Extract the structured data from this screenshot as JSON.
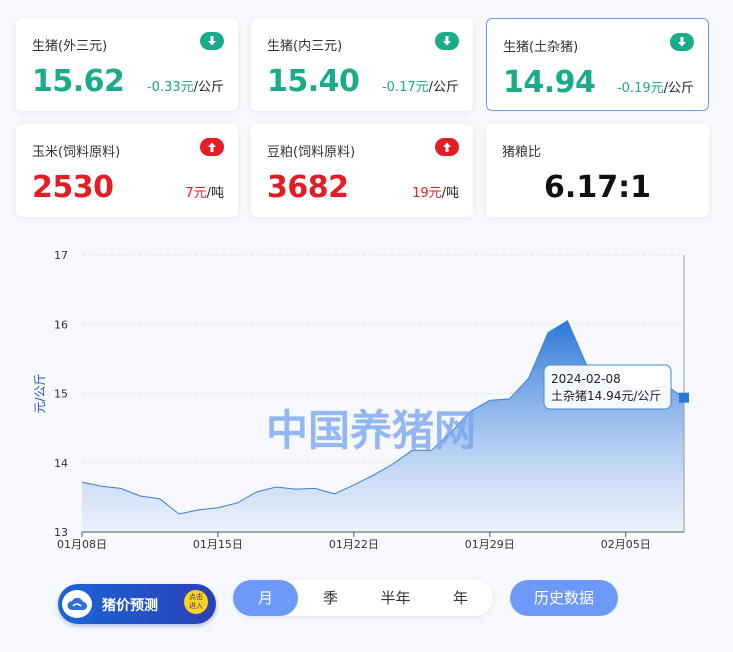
{
  "cards": [
    {
      "title": "生猪(外三元)",
      "value": "15.62",
      "change": "-0.33元",
      "unit": "/公斤",
      "trend": "down"
    },
    {
      "title": "生猪(内三元)",
      "value": "15.40",
      "change": "-0.17元",
      "unit": "/公斤",
      "trend": "down"
    },
    {
      "title": "生猪(土杂猪)",
      "value": "14.94",
      "change": "-0.19元",
      "unit": "/公斤",
      "trend": "down"
    },
    {
      "title": "玉米(饲料原料)",
      "value": "2530",
      "change": "7元",
      "unit": "/吨",
      "trend": "up"
    },
    {
      "title": "豆粕(饲料原料)",
      "value": "3682",
      "change": "19元",
      "unit": "/吨",
      "trend": "up"
    },
    {
      "title": "猪粮比",
      "value": "6.17:1"
    }
  ],
  "colors": {
    "down": "#1aab8a",
    "up": "#e41c24",
    "accent": "#6d9af8",
    "series": "#3a7fd5"
  },
  "chart_data": {
    "type": "area",
    "ylabel": "元/公斤",
    "ylim": [
      13,
      17
    ],
    "yticks": [
      13,
      14,
      15,
      16,
      17
    ],
    "xlim": [
      "2024-01-08",
      "2024-02-08"
    ],
    "xticks": [
      "01月08日",
      "01月15日",
      "01月22日",
      "01月29日",
      "02月05日"
    ],
    "grid": true,
    "watermark": "中国养猪网",
    "series": [
      {
        "name": "土杂猪",
        "values": [
          [
            "2024-01-08",
            13.72
          ],
          [
            "2024-01-09",
            13.66
          ],
          [
            "2024-01-10",
            13.63
          ],
          [
            "2024-01-11",
            13.52
          ],
          [
            "2024-01-12",
            13.48
          ],
          [
            "2024-01-13",
            13.26
          ],
          [
            "2024-01-14",
            13.32
          ],
          [
            "2024-01-15",
            13.35
          ],
          [
            "2024-01-16",
            13.42
          ],
          [
            "2024-01-17",
            13.58
          ],
          [
            "2024-01-18",
            13.65
          ],
          [
            "2024-01-19",
            13.62
          ],
          [
            "2024-01-20",
            13.63
          ],
          [
            "2024-01-21",
            13.55
          ],
          [
            "2024-01-22",
            13.68
          ],
          [
            "2024-01-23",
            13.82
          ],
          [
            "2024-01-24",
            13.98
          ],
          [
            "2024-01-25",
            14.18
          ],
          [
            "2024-01-26",
            14.18
          ],
          [
            "2024-01-27",
            14.44
          ],
          [
            "2024-01-28",
            14.74
          ],
          [
            "2024-01-29",
            14.9
          ],
          [
            "2024-01-30",
            14.92
          ],
          [
            "2024-01-31",
            15.22
          ],
          [
            "2024-02-01",
            15.88
          ],
          [
            "2024-02-02",
            16.05
          ],
          [
            "2024-02-03",
            15.4
          ],
          [
            "2024-02-04",
            15.22
          ],
          [
            "2024-02-05",
            15.12
          ],
          [
            "2024-02-06",
            15.02
          ],
          [
            "2024-02-07",
            15.13
          ],
          [
            "2024-02-08",
            14.94
          ]
        ]
      }
    ],
    "tooltip": {
      "date": "2024-02-08",
      "text": "土杂猪14.94元/公斤"
    }
  },
  "controls": {
    "forecast_label": "猪价预测",
    "forecast_enter_line1": "点击",
    "forecast_enter_line2": "进入",
    "tabs": [
      "月",
      "季",
      "半年",
      "年"
    ],
    "active_tab": "月",
    "history_label": "历史数据"
  }
}
